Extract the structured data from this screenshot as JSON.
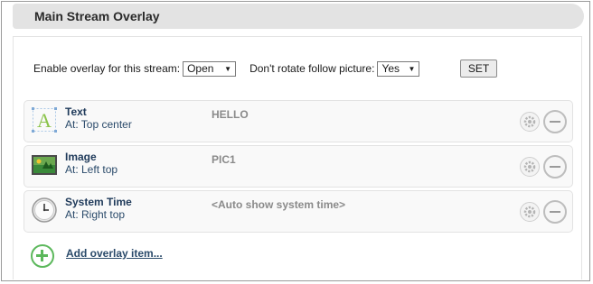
{
  "header": {
    "title": "Main Stream Overlay"
  },
  "settings": {
    "enable_label": "Enable overlay for this stream:",
    "enable_value": "Open",
    "rotate_label": "Don't rotate follow picture:",
    "rotate_value": "Yes",
    "set_label": "SET"
  },
  "items": [
    {
      "name": "Text",
      "position": "At: Top center",
      "value": "HELLO",
      "icon": "text-icon"
    },
    {
      "name": "Image",
      "position": "At: Left top",
      "value": "PIC1",
      "icon": "image-icon"
    },
    {
      "name": "System Time",
      "position": "At: Right top",
      "value": "<Auto show system time>",
      "icon": "clock-icon"
    }
  ],
  "add_item": {
    "label": "Add overlay item..."
  },
  "colors": {
    "accent_green": "#5cb85c",
    "header_bg": "#e3e3e3",
    "value_gray": "#8a8a8a"
  }
}
